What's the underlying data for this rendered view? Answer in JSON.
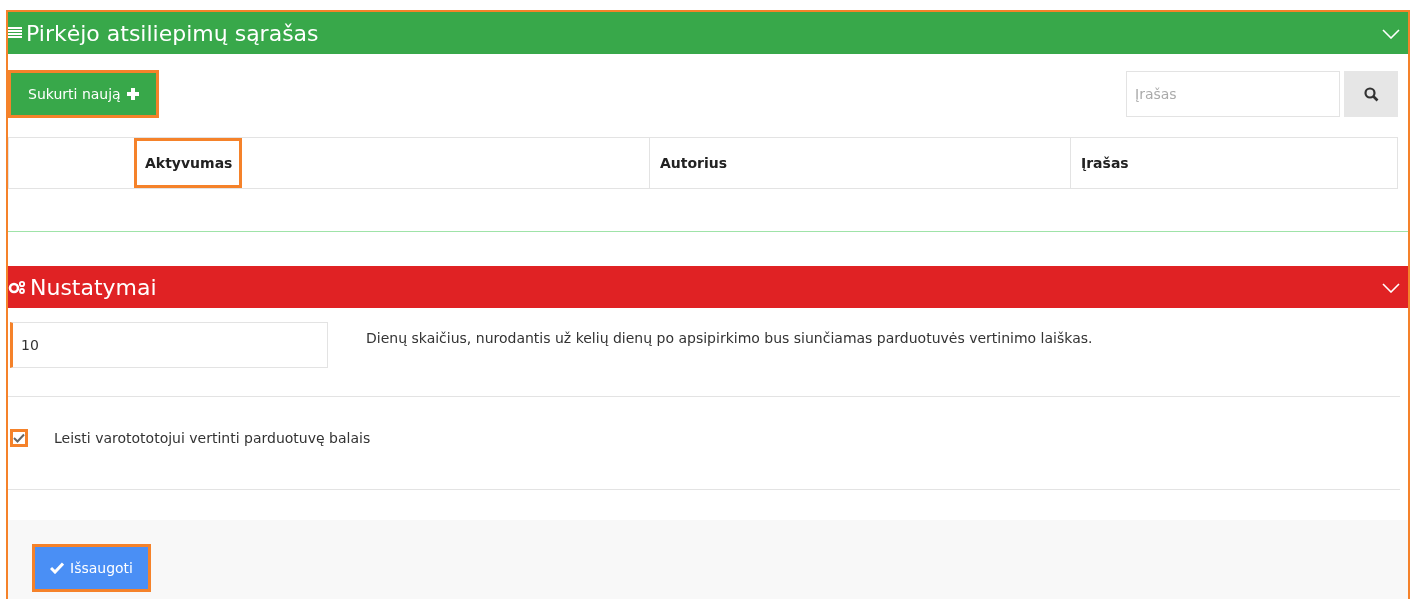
{
  "feedback_panel": {
    "title": "Pirkėjo atsiliepimų sąrašas",
    "expanded": true,
    "create_button": "Sukurti naują",
    "search": {
      "placeholder": "Įrašas"
    },
    "table": {
      "columns": [
        "",
        "Aktyvumas",
        "Autorius",
        "Įrašas"
      ]
    }
  },
  "settings_panel": {
    "title": "Nustatymai",
    "expanded": true,
    "days_field": {
      "value": "10",
      "description": "Dienų skaičius, nurodantis už kelių dienų po apsipirkimo bus siunčiamas parduotuvės vertinimo laiškas."
    },
    "rating_option": {
      "label": "Leisti varotototojui vertinti parduotuvę balais",
      "checked": true
    },
    "save_button": "Išsaugoti"
  }
}
